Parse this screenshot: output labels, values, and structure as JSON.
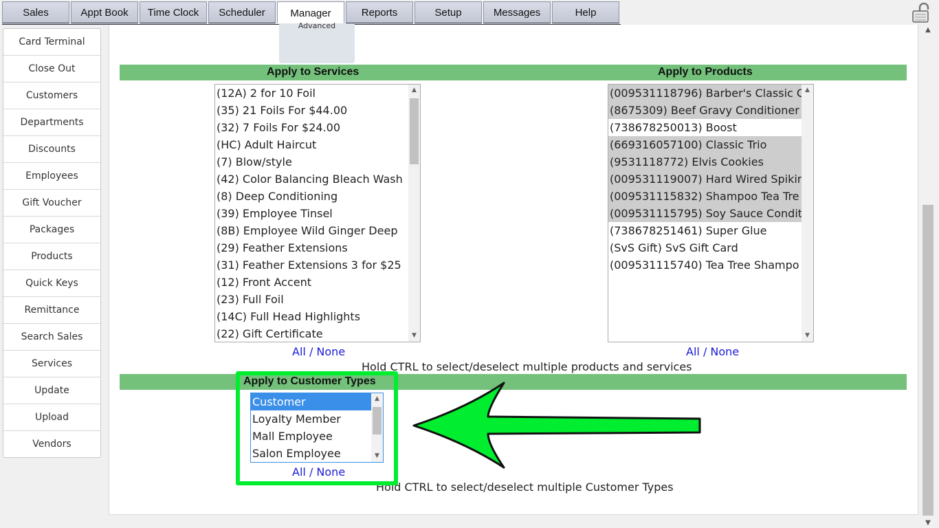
{
  "nav": {
    "tabs": [
      "Sales",
      "Appt Book",
      "Time Clock",
      "Scheduler",
      "Manager",
      "Reports",
      "Setup",
      "Messages",
      "Help"
    ],
    "active_tab": "Manager"
  },
  "sidebar": {
    "items": [
      "Card Terminal",
      "Close Out",
      "Customers",
      "Departments",
      "Discounts",
      "Employees",
      "Gift Voucher",
      "Packages",
      "Products",
      "Quick Keys",
      "Remittance",
      "Search Sales",
      "Services",
      "Update",
      "Upload",
      "Vendors"
    ]
  },
  "subtab": {
    "label": "Advanced"
  },
  "services": {
    "title": "Apply to Services",
    "options": [
      "(12A)  2 for 10 Foil",
      "(35)  21 Foils For $44.00",
      "(32)  7 Foils For $24.00",
      "(HC)  Adult Haircut",
      "(7)  Blow/style",
      "(42)  Color Balancing Bleach Wash",
      "(8)  Deep Conditioning",
      "(39)  Employee Tinsel",
      "(8B)  Employee Wild Ginger Deep",
      "(29)  Feather Extensions",
      "(31)  Feather Extensions 3 for $25",
      "(12)  Front Accent",
      "(23)  Full Foil",
      "(14C)  Full Head Highlights",
      "(22)  Gift Certificate"
    ],
    "all": "All",
    "sep": "/",
    "none": "None"
  },
  "products": {
    "title": "Apply to Products",
    "options": [
      "(009531118796)  Barber's Classic C",
      "(8675309)  Beef Gravy Conditioner",
      "(738678250013)  Boost",
      "(669316057100)  Classic Trio",
      "(9531118772)  Elvis Cookies",
      "(009531119007)  Hard Wired Spikin",
      "(009531115832)  Shampoo Tea Tre",
      "(009531115795)  Soy Sauce Condit",
      "(738678251461)  Super Glue",
      "(SvS Gift)  SvS Gift Card",
      "(009531115740)  Tea Tree Shampo"
    ],
    "selected": [
      true,
      true,
      false,
      true,
      true,
      true,
      true,
      true,
      false,
      false,
      false
    ],
    "all": "All",
    "sep": "/",
    "none": "None"
  },
  "hint_products": "Hold CTRL to select/deselect multiple products and services",
  "customer_types": {
    "title": "Apply to Customer Types",
    "options": [
      "Customer",
      "Loyalty Member",
      "Mall Employee",
      "Salon Employee"
    ],
    "all": "All",
    "sep": "/",
    "none": "None"
  },
  "hint_customers": "Hold CTRL to select/deselect multiple Customer Types",
  "colors": {
    "highlight": "#00ee2f",
    "section_bar": "#73c17a",
    "link": "#1a1ad6",
    "selected_focus": "#3a8fe8"
  },
  "icons": {
    "lock": "lock-icon",
    "arrow": "arrow-left-icon"
  }
}
